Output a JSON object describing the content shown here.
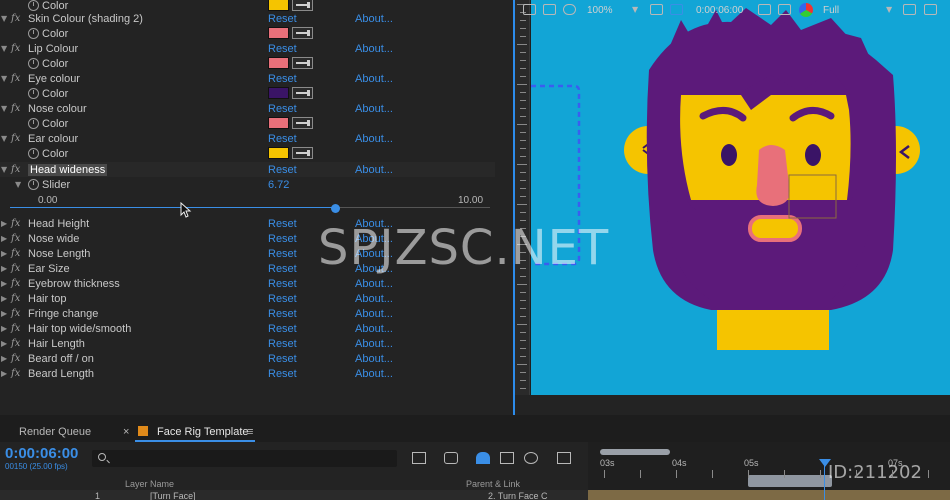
{
  "effects": {
    "top_partial": {
      "label": "Color",
      "swatch": "#f5c400"
    },
    "rows": [
      {
        "name": "Skin Colour (shading 2)",
        "reset": "Reset",
        "about": "About...",
        "sub_label": "Color",
        "swatch": "#e8707a"
      },
      {
        "name": "Lip Colour",
        "reset": "Reset",
        "about": "About...",
        "sub_label": "Color",
        "swatch": "#e8707a"
      },
      {
        "name": "Eye colour",
        "reset": "Reset",
        "about": "About...",
        "sub_label": "Color",
        "swatch": "#3a1466"
      },
      {
        "name": "Nose colour",
        "reset": "Reset",
        "about": "About...",
        "sub_label": "Color",
        "swatch": "#e8707a"
      },
      {
        "name": "Ear colour",
        "reset": "Reset",
        "about": "About...",
        "sub_label": "Color",
        "swatch": "#f5c400"
      }
    ],
    "selected": {
      "name": "Head wideness",
      "reset": "Reset",
      "about": "About...",
      "sub_label": "Slider",
      "value": "6.72",
      "range_min": "0.00",
      "range_max": "10.00",
      "slider_fraction": 0.672
    },
    "collapsed": [
      {
        "name": "Head Height",
        "reset": "Reset",
        "about": "About..."
      },
      {
        "name": "Nose wide",
        "reset": "Reset",
        "about": "About..."
      },
      {
        "name": "Nose Length",
        "reset": "Reset",
        "about": "About..."
      },
      {
        "name": "Ear Size",
        "reset": "Reset",
        "about": "About..."
      },
      {
        "name": "Eyebrow thickness",
        "reset": "Reset",
        "about": "About..."
      },
      {
        "name": "Hair top",
        "reset": "Reset",
        "about": "About..."
      },
      {
        "name": "Fringe change",
        "reset": "Reset",
        "about": "About..."
      },
      {
        "name": "Hair top wide/smooth",
        "reset": "Reset",
        "about": "About..."
      },
      {
        "name": "Hair Length",
        "reset": "Reset",
        "about": "About..."
      },
      {
        "name": "Beard off / on",
        "reset": "Reset",
        "about": "About..."
      },
      {
        "name": "Beard Length",
        "reset": "Reset",
        "about": "About..."
      }
    ],
    "fx_glyph": "fx"
  },
  "viewer": {
    "background": "#12a5d6",
    "zoom": "100%",
    "timecode": "0:00:06:00",
    "resolution": "Full",
    "watermark": "SPJZSC.NET",
    "watermark_id": "ID:211202",
    "colors": {
      "hair": "#5c1a7a",
      "skin": "#f5c400",
      "nose": "#e8707a",
      "eye": "#3a1466",
      "selection": "#3a5ef0"
    }
  },
  "timeline": {
    "tabs": {
      "render_queue": "Render Queue",
      "comp": "Face Rig Template",
      "close": "×",
      "menu": "≡",
      "comp_color": "#e08a1a"
    },
    "timecode": "0:00:06:00",
    "fps": "00150 (25.00 fps)",
    "search_placeholder": "ρ▾",
    "columns": {
      "layer_name": "Layer Name",
      "parent": "Parent & Link"
    },
    "layer": {
      "number": "1",
      "name": "[Turn Face]",
      "parent": "2. Turn Face C"
    },
    "time_labels": [
      "03s",
      "04s",
      "05s",
      "07s"
    ],
    "playhead_seconds": 6.0,
    "track_color": "#7d6a45"
  }
}
